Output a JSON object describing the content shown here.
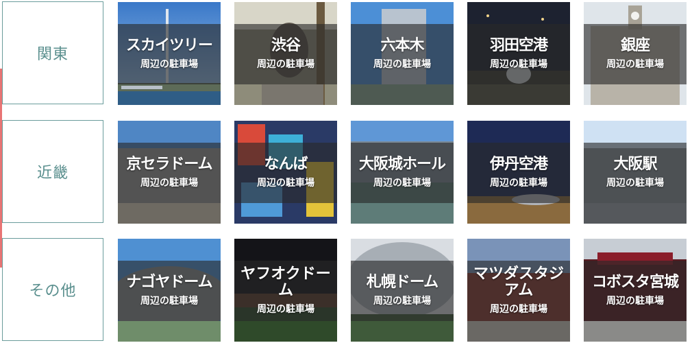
{
  "regions": [
    {
      "label": "関東"
    },
    {
      "label": "近畿"
    },
    {
      "label": "その他"
    }
  ],
  "sub_label": "周辺の駐車場",
  "rows": [
    [
      {
        "name": "スカイツリー",
        "icon": "skytree-photo"
      },
      {
        "name": "渋谷",
        "icon": "hachiko-statue-photo"
      },
      {
        "name": "六本木",
        "icon": "roppongi-tower-photo"
      },
      {
        "name": "羽田空港",
        "icon": "haneda-airport-photo"
      },
      {
        "name": "銀座",
        "icon": "ginza-clocktower-photo"
      }
    ],
    [
      {
        "name": "京セラドーム",
        "icon": "kyocera-dome-photo"
      },
      {
        "name": "なんば",
        "icon": "namba-billboards-photo"
      },
      {
        "name": "大阪城ホール",
        "icon": "osaka-castle-hall-photo"
      },
      {
        "name": "伊丹空港",
        "icon": "itami-airport-photo"
      },
      {
        "name": "大阪駅",
        "icon": "osaka-station-photo"
      }
    ],
    [
      {
        "name": "ナゴヤドーム",
        "icon": "nagoya-dome-photo"
      },
      {
        "name": "ヤフオクドーム",
        "icon": "yafuoku-dome-photo"
      },
      {
        "name": "札幌ドーム",
        "icon": "sapporo-dome-photo"
      },
      {
        "name": "マツダスタジアム",
        "icon": "mazda-stadium-photo"
      },
      {
        "name": "コボスタ宮城",
        "icon": "kobo-stadium-photo"
      }
    ]
  ],
  "colors": {
    "region_border": "#6a9c9b",
    "region_text": "#5a8f8e",
    "accent_bar": "#e87474"
  }
}
